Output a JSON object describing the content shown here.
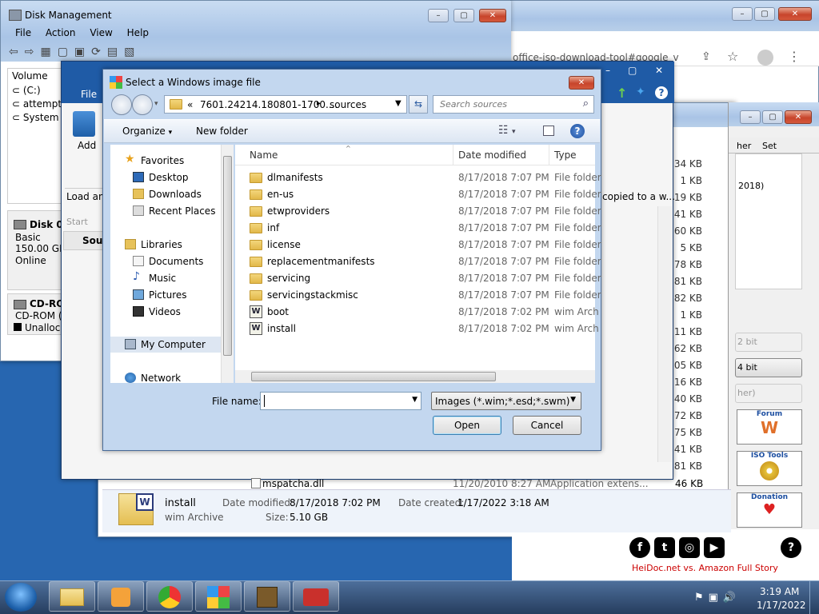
{
  "disk_mgmt": {
    "title": "Disk Management",
    "menu": [
      "File",
      "Action",
      "View",
      "Help"
    ],
    "volume_header": "Volume",
    "volumes": [
      "(C:)",
      "attempt",
      "System R"
    ],
    "disk0": {
      "name": "Disk 0",
      "type": "Basic",
      "size": "150.00 GB",
      "status": "Online"
    },
    "cdrom": {
      "name": "CD-RO",
      "line2": "CD-ROM (",
      "unalloc": "Unalloca"
    }
  },
  "tool_window": {
    "file_tab": "File",
    "add_label": "Add",
    "load_text": "Load an",
    "start_label": "Start",
    "source_label": "Sour"
  },
  "browser": {
    "url": "office-iso-download-tool#google_v"
  },
  "explorer_bg": {
    "sizes": [
      "34 KB",
      "1 KB",
      "19 KB",
      "41 KB",
      "60 KB",
      "5 KB",
      "78 KB",
      "81 KB",
      "82 KB",
      "1 KB",
      "11 KB",
      "62 KB",
      "05 KB",
      "16 KB",
      "40 KB",
      "72 KB",
      "75 KB",
      "41 KB",
      "81 KB"
    ],
    "copied_text": "copied to a w...",
    "last_file": {
      "name": "mspatcha.dll",
      "date": "11/20/2010 8:27 AM",
      "type": "Application extens...",
      "size": "46 KB"
    },
    "details": {
      "name": "install",
      "type": "wim Archive",
      "date_modified_label": "Date modified:",
      "date_modified": "8/17/2018 7:02 PM",
      "date_created_label": "Date created:",
      "date_created": "1/17/2022 3:18 AM",
      "size_label": "Size:",
      "size": "5.10 GB"
    }
  },
  "right_panel": {
    "col1": "her",
    "col2": "Set",
    "year": "2018)",
    "bit1": "2 bit",
    "bit2": "4 bit",
    "her2": "her)",
    "forum": "Forum",
    "iso_tools": "ISO Tools",
    "donation": "Donation",
    "story_link": "HeiDoc.net vs. Amazon Full Story"
  },
  "dialog": {
    "title": "Select a Windows image file",
    "breadcrumb_prefix": "«",
    "breadcrumb_path": "7601.24214.180801-1700....",
    "breadcrumb_sep": "▸",
    "breadcrumb_current": "sources",
    "search_placeholder": "Search sources",
    "organize": "Organize",
    "new_folder": "New folder",
    "nav": {
      "favorites": "Favorites",
      "desktop": "Desktop",
      "downloads": "Downloads",
      "recent": "Recent Places",
      "libraries": "Libraries",
      "documents": "Documents",
      "music": "Music",
      "pictures": "Pictures",
      "videos": "Videos",
      "computer": "My Computer",
      "network": "Network"
    },
    "columns": {
      "name": "Name",
      "date": "Date modified",
      "type": "Type"
    },
    "files": [
      {
        "name": "dlmanifests",
        "date": "8/17/2018 7:07 PM",
        "type": "File folder",
        "icon": "folder"
      },
      {
        "name": "en-us",
        "date": "8/17/2018 7:07 PM",
        "type": "File folder",
        "icon": "folder"
      },
      {
        "name": "etwproviders",
        "date": "8/17/2018 7:07 PM",
        "type": "File folder",
        "icon": "folder"
      },
      {
        "name": "inf",
        "date": "8/17/2018 7:07 PM",
        "type": "File folder",
        "icon": "folder"
      },
      {
        "name": "license",
        "date": "8/17/2018 7:07 PM",
        "type": "File folder",
        "icon": "folder"
      },
      {
        "name": "replacementmanifests",
        "date": "8/17/2018 7:07 PM",
        "type": "File folder",
        "icon": "folder"
      },
      {
        "name": "servicing",
        "date": "8/17/2018 7:07 PM",
        "type": "File folder",
        "icon": "folder"
      },
      {
        "name": "servicingstackmisc",
        "date": "8/17/2018 7:07 PM",
        "type": "File folder",
        "icon": "folder"
      },
      {
        "name": "boot",
        "date": "8/17/2018 7:02 PM",
        "type": "wim Arch",
        "icon": "wim"
      },
      {
        "name": "install",
        "date": "8/17/2018 7:02 PM",
        "type": "wim Arch",
        "icon": "wim"
      }
    ],
    "file_name_label": "File name:",
    "file_name_value": "",
    "filter": "Images (*.wim;*.esd;*.swm)",
    "open": "Open",
    "cancel": "Cancel"
  },
  "taskbar": {
    "time": "3:19 AM",
    "date": "1/17/2022"
  }
}
